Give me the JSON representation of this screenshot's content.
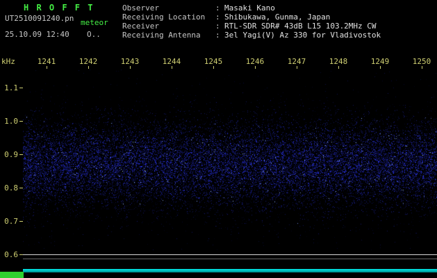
{
  "header": {
    "app_title": "H R O F F T",
    "filename": "UT2510091240.pn",
    "station_tag": "meteor",
    "datetime": "25.10.09 12:40",
    "status": "O..",
    "colon": ":",
    "info": [
      {
        "label": "Observer",
        "value": "Masaki Kano"
      },
      {
        "label": "Receiving Location",
        "value": "Shibukawa, Gunma, Japan"
      },
      {
        "label": "Receiver",
        "value": "RTL-SDR SDR# 43dB L15 103.2MHz CW"
      },
      {
        "label": "Receiving Antenna",
        "value": "3el Yagi(V) Az 330 for Vladivostok"
      }
    ]
  },
  "chart_data": {
    "type": "heatmap",
    "title": "H R O F F T",
    "x_ticks": [
      "1241",
      "1242",
      "1243",
      "1244",
      "1245",
      "1246",
      "1247",
      "1248",
      "1249",
      "1250"
    ],
    "ylabel": "kHz",
    "y_ticks": [
      "1.1",
      "1.0",
      "0.9",
      "0.8",
      "0.7",
      "0.6"
    ],
    "y_range_khz": [
      0.6,
      1.15
    ],
    "noise_band": {
      "center_khz": 0.87,
      "sigma_khz": 0.065,
      "min_khz": 0.74,
      "max_khz": 1.02
    },
    "signal_level": {
      "shape": "flat",
      "color": "#00c8c8"
    },
    "grid": false,
    "legend": false
  },
  "colors": {
    "background": "#000000",
    "title_green": "#44ee44",
    "axis_yellow": "#cfcf72",
    "header_text": "#c6c6c6",
    "noise_blue": "#2233cc",
    "level_cyan": "#00c8c8",
    "marker_green": "#2fd02f"
  }
}
